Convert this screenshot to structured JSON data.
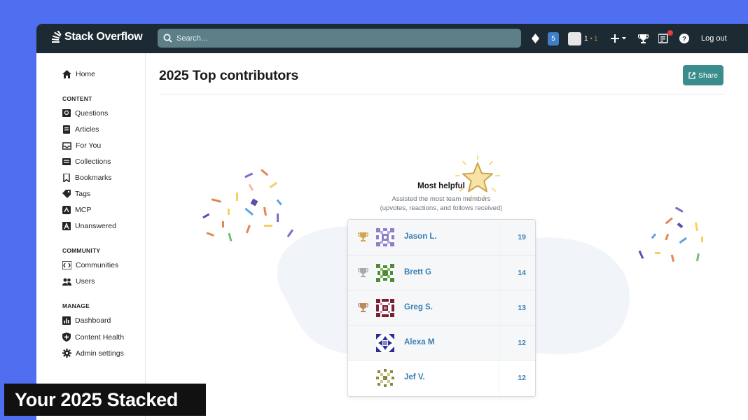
{
  "topbar": {
    "brand": "Stack Overflow",
    "search_placeholder": "Search...",
    "inbox_count": "5",
    "reputation": "1",
    "bronze_badges": "• 1",
    "logout_label": "Log out"
  },
  "sidebar": {
    "home": "Home",
    "content_heading": "CONTENT",
    "content_items": [
      "Questions",
      "Articles",
      "For You",
      "Collections",
      "Bookmarks",
      "Tags",
      "MCP",
      "Unanswered"
    ],
    "community_heading": "COMMUNITY",
    "community_items": [
      "Communities",
      "Users"
    ],
    "manage_heading": "MANAGE",
    "manage_items": [
      "Dashboard",
      "Content Health",
      "Admin settings"
    ]
  },
  "main": {
    "title": "2025 Top contributors",
    "share_label": "Share",
    "award": {
      "title": "Most helpful",
      "description_line1": "Assisted the most team members",
      "description_line2": "(upvotes, reactions, and follows received)"
    },
    "leaderboard": [
      {
        "name": "Jason L.",
        "score": "19",
        "trophy": "gold"
      },
      {
        "name": "Brett G",
        "score": "14",
        "trophy": "silver"
      },
      {
        "name": "Greg S.",
        "score": "13",
        "trophy": "bronze"
      },
      {
        "name": "Alexa M",
        "score": "12",
        "trophy": "none"
      },
      {
        "name": "Jef V.",
        "score": "12",
        "trophy": "none"
      }
    ]
  },
  "caption": "Your 2025 Stacked",
  "colors": {
    "background": "#4f6ff0",
    "topbar": "#1c2b33",
    "accent_teal": "#3b8c8c",
    "link_blue": "#3a7fb3",
    "gold": "#d4a54a",
    "silver": "#a9a9a9",
    "bronze": "#b98a5c"
  }
}
